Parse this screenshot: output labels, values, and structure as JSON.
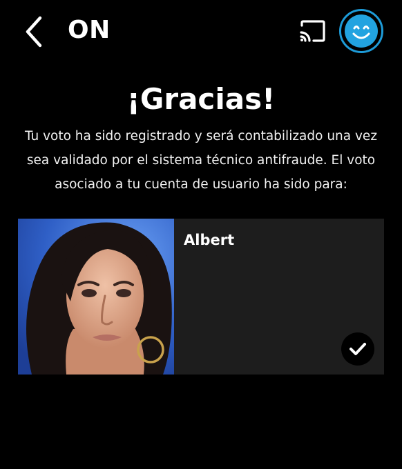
{
  "header": {
    "title": "ON",
    "back_icon": "chevron-left-icon",
    "cast_icon": "cast-icon",
    "profile_icon": "smiley-avatar-icon",
    "accent_color": "#22a3e0"
  },
  "confirmation": {
    "heading": "¡Gracias!",
    "message": "Tu voto ha sido registrado y será contabilizado una vez sea validado por el sistema técnico antifraude. El voto asociado a tu cuenta de usuario ha sido para:"
  },
  "vote": {
    "candidate_name": "Albert",
    "selected_icon": "checkmark-icon"
  },
  "colors": {
    "background": "#000000",
    "card": "#1d1d1d",
    "text": "#ffffff"
  }
}
